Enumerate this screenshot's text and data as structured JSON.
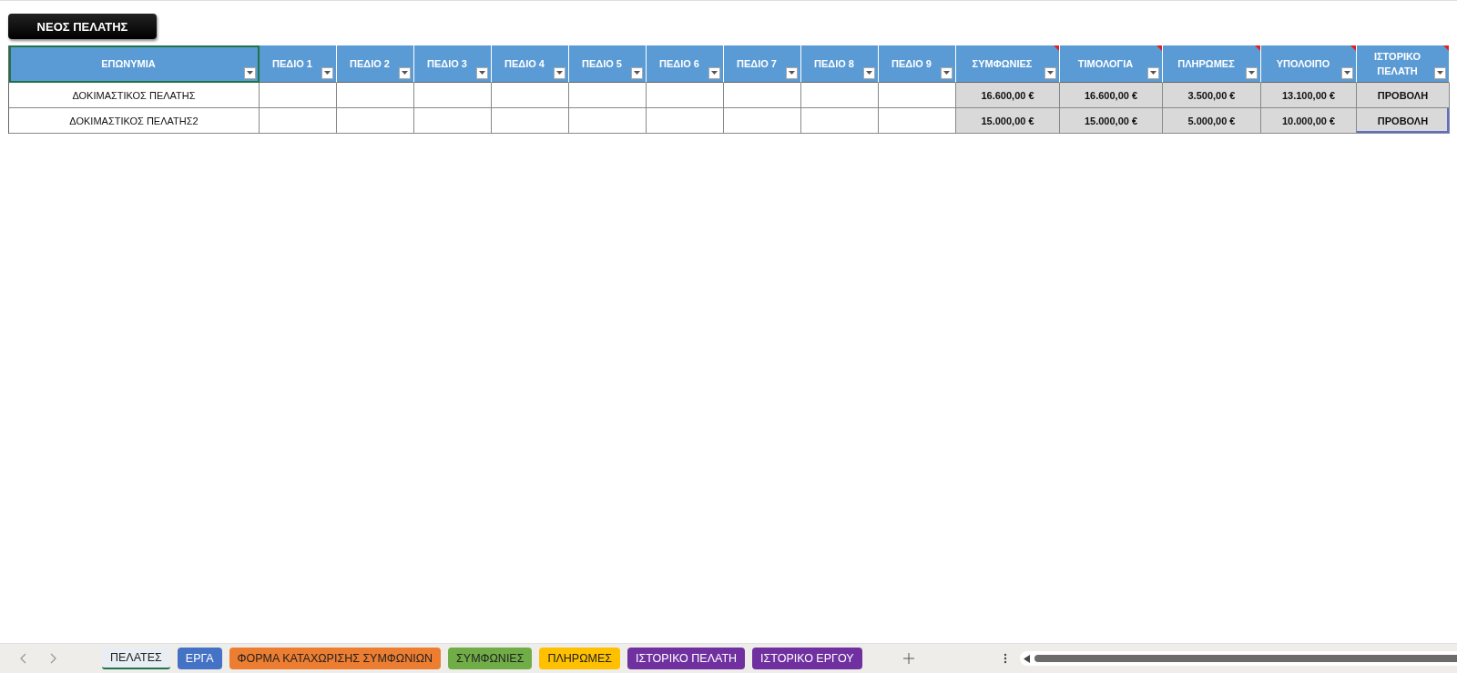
{
  "new_button": "ΝΕΟΣ ΠΕΛΑΤΗΣ",
  "table": {
    "columns": [
      {
        "label": "ΕΠΩΝΥΜΙΑ",
        "kind": "name",
        "selected": true,
        "note": false
      },
      {
        "label": "ΠΕΔΙΟ 1",
        "kind": "field",
        "selected": false,
        "note": false
      },
      {
        "label": "ΠΕΔΙΟ 2",
        "kind": "field",
        "selected": false,
        "note": false
      },
      {
        "label": "ΠΕΔΙΟ 3",
        "kind": "field",
        "selected": false,
        "note": false
      },
      {
        "label": "ΠΕΔΙΟ 4",
        "kind": "field",
        "selected": false,
        "note": false
      },
      {
        "label": "ΠΕΔΙΟ 5",
        "kind": "field",
        "selected": false,
        "note": false
      },
      {
        "label": "ΠΕΔΙΟ 6",
        "kind": "field",
        "selected": false,
        "note": false
      },
      {
        "label": "ΠΕΔΙΟ 7",
        "kind": "field",
        "selected": false,
        "note": false
      },
      {
        "label": "ΠΕΔΙΟ 8",
        "kind": "field",
        "selected": false,
        "note": false
      },
      {
        "label": "ΠΕΔΙΟ 9",
        "kind": "field",
        "selected": false,
        "note": false
      },
      {
        "label": "ΣΥΜΦΩΝΙΕΣ",
        "kind": "total",
        "selected": false,
        "note": true
      },
      {
        "label": "ΤΙΜΟΛΟΓΙΑ",
        "kind": "total",
        "selected": false,
        "note": true
      },
      {
        "label": "ΠΛΗΡΩΜΕΣ",
        "kind": "total",
        "selected": false,
        "note": true
      },
      {
        "label": "ΥΠΟΛΟΙΠΟ",
        "kind": "total",
        "selected": false,
        "note": true
      },
      {
        "label": "ΙΣΤΟΡΙΚΟ ΠΕΛΑΤΗ",
        "kind": "action",
        "selected": false,
        "note": true
      }
    ],
    "rows": [
      {
        "name": "ΔΟΚΙΜΑΣΤΙΚΟΣ ΠΕΛΑΤΗΣ",
        "totals": [
          "16.600,00 €",
          "16.600,00 €",
          "3.500,00 €",
          "13.100,00 €"
        ],
        "action": "ΠΡΟΒΟΛΗ"
      },
      {
        "name": "ΔΟΚΙΜΑΣΤΙΚΟΣ ΠΕΛΑΤΗΣ2",
        "totals": [
          "15.000,00 €",
          "15.000,00 €",
          "5.000,00 €",
          "10.000,00 €"
        ],
        "action": "ΠΡΟΒΟΛΗ"
      }
    ]
  },
  "sheet_tabs": [
    {
      "label": "ΠΕΛΑΤΕΣ",
      "selected": true,
      "color": "#e8eef4"
    },
    {
      "label": "ΕΡΓΑ",
      "selected": false,
      "color": "#4472c4"
    },
    {
      "label": "ΦΟΡΜΑ ΚΑΤΑΧΩΡΙΣΗΣ ΣΥΜΦΩΝΙΩΝ",
      "selected": false,
      "color": "#ed7d31"
    },
    {
      "label": "ΣΥΜΦΩΝΙΕΣ",
      "selected": false,
      "color": "#70ad47"
    },
    {
      "label": "ΠΛΗΡΩΜΕΣ",
      "selected": false,
      "color": "#ffc000"
    },
    {
      "label": "ΙΣΤΟΡΙΚΟ ΠΕΛΑΤΗ",
      "selected": false,
      "color": "#7030a0"
    },
    {
      "label": "ΙΣΤΟΡΙΚΟ ΕΡΓΟΥ",
      "selected": false,
      "color": "#7030a0"
    }
  ]
}
